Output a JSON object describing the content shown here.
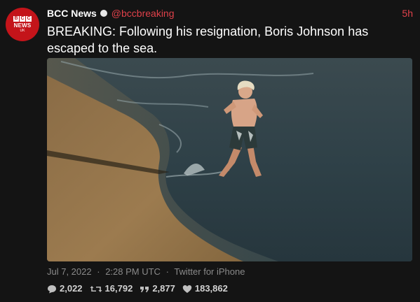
{
  "account": {
    "name": "BCC News",
    "handle": "@bccbreaking",
    "avatar_letters": [
      "B",
      "C",
      "C"
    ],
    "avatar_news": "NEWS",
    "avatar_uk": "UK"
  },
  "tweet": {
    "time_ago": "5h",
    "text": "BREAKING: Following his resignation, Boris Johnson has escaped to the sea.",
    "date": "Jul 7, 2022",
    "clock": "2:28 PM UTC",
    "source": "Twitter for iPhone",
    "separator": "·"
  },
  "stats": {
    "replies": "2,022",
    "retweets": "16,792",
    "quotes": "2,877",
    "likes": "183,862"
  },
  "icons": {
    "verified": "verified-badge-icon",
    "reply": "speech-bubble-icon",
    "retweet": "retweet-arrows-icon",
    "quote": "quote-marks-icon",
    "like": "heart-icon"
  },
  "colors": {
    "background": "#141414",
    "handle": "#e0414a",
    "avatar": "#c4141a",
    "meta": "#8a8a8a"
  }
}
